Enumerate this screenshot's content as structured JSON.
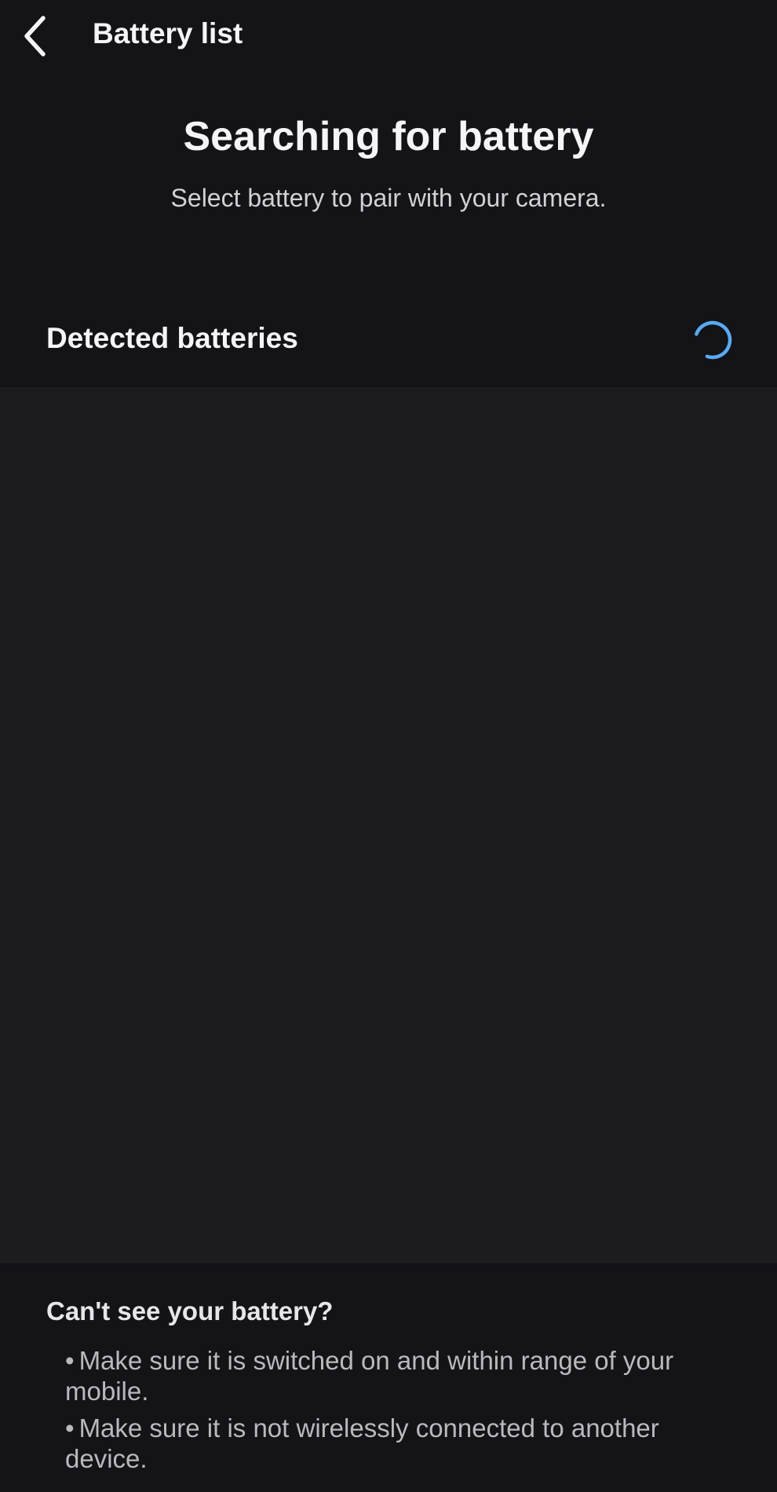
{
  "top_bar": {
    "back_icon": "chevron-left-icon",
    "title": "Battery list"
  },
  "header": {
    "title": "Searching for battery",
    "subtitle": "Select battery to pair with your camera."
  },
  "detected": {
    "label": "Detected batteries",
    "spinner_icon": "loading-spinner-icon",
    "spinner_color": "#5aa9f2",
    "items": []
  },
  "help": {
    "heading": "Can't see your battery?",
    "bullet": "•",
    "tips": [
      "Make sure it is switched on and within range of your mobile.",
      "Make sure it is not wirelessly connected to another device."
    ]
  },
  "colors": {
    "background": "#131318",
    "list_background": "#1c1c1e",
    "accent": "#5aa9f2"
  }
}
